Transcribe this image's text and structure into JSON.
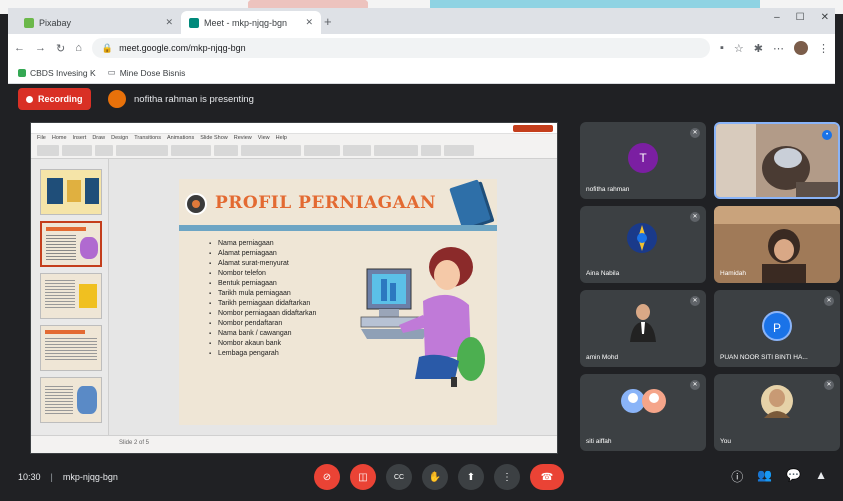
{
  "browser": {
    "tabs": [
      {
        "label": "Pixabay",
        "fav_color": "#6bb84a"
      },
      {
        "label": "Meet - mkp-njqg-bgn",
        "fav_color": "#00897b"
      }
    ],
    "url": "meet.google.com/mkp-njqg-bgn",
    "bookmarks": [
      "CBDS Invesing K",
      "Mine Dose Bisnis"
    ],
    "new_tab": "+",
    "min": "–",
    "max": "☐",
    "close": "✕"
  },
  "meet": {
    "recording_label": "Recording",
    "presenter_label": "nofitha rahman is presenting",
    "meeting_code": "10:30",
    "meeting_id": "mkp-njqg-bgn"
  },
  "slide": {
    "title": "PROFIL PERNIAGAAN",
    "bullets": [
      "Nama perniagaan",
      "Alamat perniagaan",
      "Alamat surat-menyurat",
      "Nombor telefon",
      "Bentuk perniagaan",
      "Tarikh mula perniagaan",
      "Tarikh perniagaan didaftarkan",
      "Nombor perniagaan didaftarkan",
      "Nombor pendaftaran",
      "Nama bank / cawangan",
      "Nombor akaun bank",
      "Lembaga pengarah"
    ]
  },
  "ppt": {
    "menu": [
      "File",
      "Home",
      "Insert",
      "Draw",
      "Design",
      "Transitions",
      "Animations",
      "Slide Show",
      "Review",
      "View",
      "Help"
    ],
    "status": "Slide 2 of 5"
  },
  "participants": [
    {
      "name": "nofitha rahman",
      "initial": "T",
      "color": "#7b1fa2",
      "type": "avatar"
    },
    {
      "name": "",
      "initial": "",
      "color": "",
      "type": "video"
    },
    {
      "name": "Aina Nabila",
      "initial": "",
      "color": "#1a73e8",
      "type": "logo"
    },
    {
      "name": "Hamidah",
      "initial": "",
      "color": "",
      "type": "video2"
    },
    {
      "name": "amin Mohd",
      "initial": "",
      "color": "",
      "type": "person"
    },
    {
      "name": "PUAN NOOR SITI BINTI HA...",
      "initial": "P",
      "color": "#1a73e8",
      "type": "avatar"
    },
    {
      "name": "siti aiffah",
      "initial": "",
      "color": "",
      "type": "duo"
    },
    {
      "name": "You",
      "initial": "",
      "color": "",
      "type": "self"
    }
  ],
  "controls": {
    "mic": "🎤",
    "cam": "▣",
    "cc": "CC",
    "hand": "✋",
    "present": "⬆",
    "more": "⋮",
    "end": "☎"
  },
  "right_controls": [
    "ⓘ",
    "👥",
    "💬",
    "▲"
  ]
}
